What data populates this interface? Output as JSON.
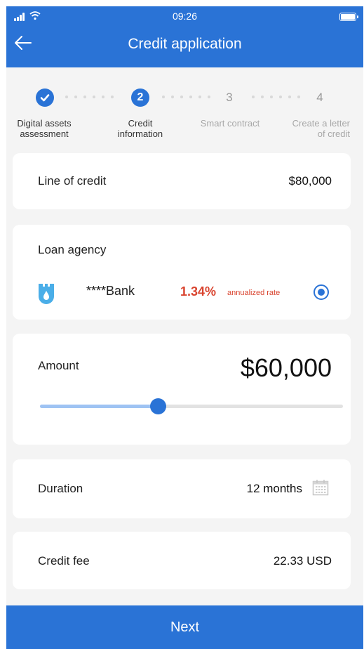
{
  "status_bar": {
    "time": "09:26"
  },
  "header": {
    "title": "Credit application"
  },
  "steps": [
    {
      "number": "1",
      "label_line1": "Digital assets",
      "label_line2": "assessment"
    },
    {
      "number": "2",
      "label_line1": "Credit",
      "label_line2": "information"
    },
    {
      "number": "3",
      "label_line1": "Smart contract",
      "label_line2": ""
    },
    {
      "number": "4",
      "label_line1": "Create a letter",
      "label_line2": "of credit"
    }
  ],
  "line_of_credit": {
    "label": "Line of credit",
    "value": "$80,000"
  },
  "loan_agency": {
    "label": "Loan agency",
    "bank_name": "****Bank",
    "rate": "1.34%",
    "rate_label": "annualized rate",
    "selected": true
  },
  "amount": {
    "label": "Amount",
    "value": "$60,000",
    "slider_fraction": 0.39
  },
  "duration": {
    "label": "Duration",
    "value": "12 months"
  },
  "credit_fee": {
    "label": "Credit fee",
    "value": "22.33 USD"
  },
  "footer": {
    "next_label": "Next"
  },
  "colors": {
    "primary": "#2a73d6",
    "rate": "#d9442f",
    "background": "#f4f4f4",
    "slider_fill": "#9ec3f3"
  },
  "icons": {
    "back": "arrow-left-icon",
    "step_done": "check-icon",
    "bank": "bank-tower-icon",
    "calendar": "calendar-icon"
  }
}
